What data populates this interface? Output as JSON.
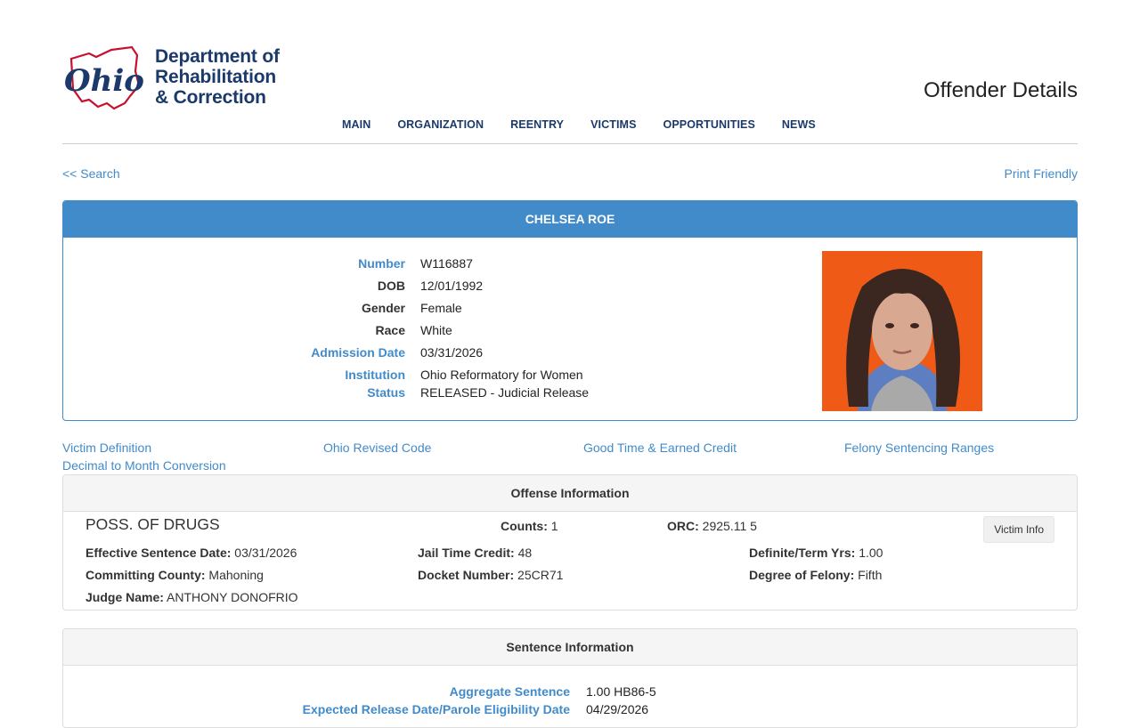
{
  "header": {
    "logo_text_line1": "Department of",
    "logo_text_line2": "Rehabilitation",
    "logo_text_line3": "& Correction",
    "logo_state_word": "Ohio",
    "page_title": "Offender Details",
    "nav": [
      "MAIN",
      "ORGANIZATION",
      "REENTRY",
      "VICTIMS",
      "OPPORTUNITIES",
      "NEWS"
    ]
  },
  "links": {
    "back": "<< Search",
    "print": "Print Friendly"
  },
  "offender": {
    "name": "CHELSEA ROE",
    "fields": [
      {
        "label": "Number",
        "value": "W116887",
        "style": "blue"
      },
      {
        "label": "DOB",
        "value": "12/01/1992",
        "style": "dark"
      },
      {
        "label": "Gender",
        "value": "Female",
        "style": "dark"
      },
      {
        "label": "Race",
        "value": "White",
        "style": "dark"
      },
      {
        "label": "Admission Date",
        "value": "03/31/2026",
        "style": "blue"
      },
      {
        "label": "Institution",
        "value": "Ohio Reformatory for Women",
        "style": "blue"
      },
      {
        "label": "Status",
        "value": "RELEASED - Judicial Release",
        "style": "blue"
      }
    ]
  },
  "reference_links": [
    "Victim Definition",
    "Ohio Revised Code",
    "Good Time & Earned Credit",
    "Felony Sentencing Ranges",
    "Decimal to Month Conversion"
  ],
  "offense": {
    "heading": "Offense Information",
    "title": "POSS. OF DRUGS",
    "counts_label": "Counts:",
    "counts_value": "1",
    "orc_label": "ORC:",
    "orc_value": "2925.11 5",
    "victim_button": "Victim Info",
    "effective_label": "Effective Sentence Date:",
    "effective_value": "03/31/2026",
    "jail_label": "Jail Time Credit:",
    "jail_value": "48",
    "definite_label": "Definite/Term Yrs:",
    "definite_value": "1.00",
    "county_label": "Committing County:",
    "county_value": "Mahoning",
    "docket_label": "Docket Number:",
    "docket_value": "25CR71",
    "degree_label": "Degree of Felony:",
    "degree_value": "Fifth",
    "judge_label": "Judge Name:",
    "judge_value": "ANTHONY DONOFRIO"
  },
  "sentence": {
    "heading": "Sentence Information",
    "rows": [
      {
        "label": "Aggregate Sentence",
        "value": "1.00 HB86-5"
      },
      {
        "label": "Expected Release Date/Parole Eligibility Date",
        "value": "04/29/2026"
      }
    ]
  }
}
